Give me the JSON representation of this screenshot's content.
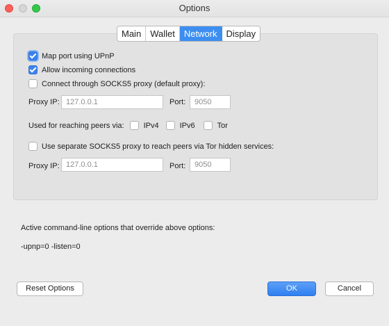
{
  "window": {
    "title": "Options"
  },
  "tabs": [
    {
      "label": "Main",
      "active": false
    },
    {
      "label": "Wallet",
      "active": false
    },
    {
      "label": "Network",
      "active": true
    },
    {
      "label": "Display",
      "active": false
    }
  ],
  "network": {
    "map_upnp": {
      "label": "Map port using UPnP",
      "checked": true
    },
    "allow_incoming": {
      "label": "Allow incoming connections",
      "checked": true
    },
    "socks5_default": {
      "label": "Connect through SOCKS5 proxy (default proxy):",
      "checked": false
    },
    "proxy1": {
      "ip_label": "Proxy IP:",
      "ip_placeholder": "127.0.0.1",
      "port_label": "Port:",
      "port_placeholder": "9050"
    },
    "reach_peers": {
      "label": "Used for reaching peers via:",
      "ipv4": "IPv4",
      "ipv6": "IPv6",
      "tor": "Tor"
    },
    "socks5_tor": {
      "label": "Use separate SOCKS5 proxy to reach peers via Tor hidden services:",
      "checked": false
    },
    "proxy2": {
      "ip_label": "Proxy IP:",
      "ip_placeholder": "127.0.0.1",
      "port_label": "Port:",
      "port_placeholder": "9050"
    }
  },
  "override": {
    "label": "Active command-line options that override above options:",
    "value": "-upnp=0 -listen=0"
  },
  "buttons": {
    "reset": "Reset Options",
    "ok": "OK",
    "cancel": "Cancel"
  },
  "colors": {
    "accent": "#3d8ef0",
    "ok_button": "#2f7ff0",
    "close": "#fc605c",
    "maximize": "#34c84a"
  }
}
